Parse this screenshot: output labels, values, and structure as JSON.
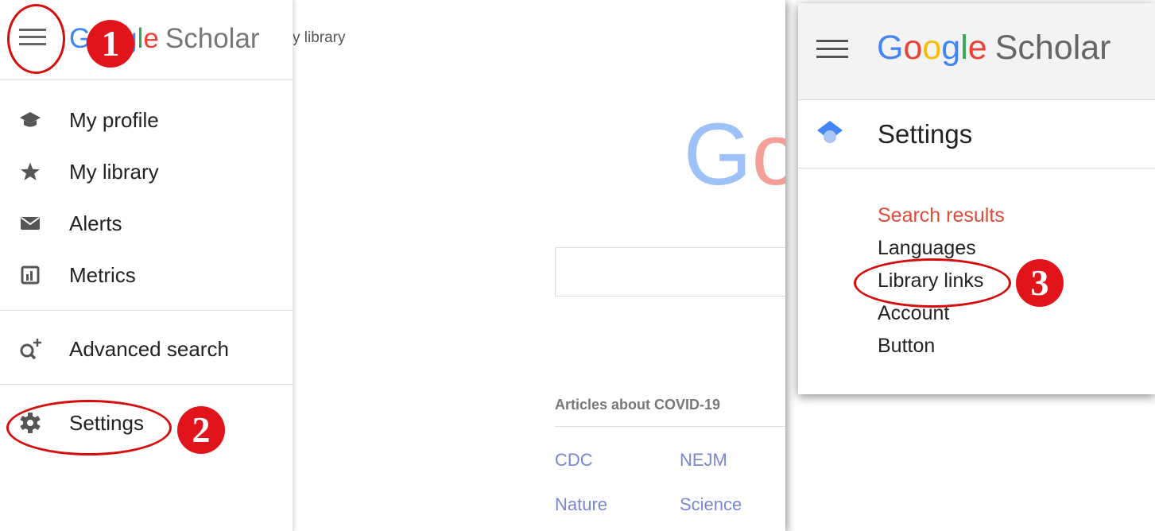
{
  "left_panel": {
    "background": {
      "breadcrumb_fragment": "y library",
      "logo_fragment": "Go",
      "articles_title": "Articles about COVID-19",
      "links": [
        "CDC",
        "NEJM",
        "Nature",
        "Science"
      ]
    },
    "drawer": {
      "logo": {
        "g": "G",
        "o1": "o",
        "o2": "o",
        "g2": "g",
        "l": "l",
        "e": "e",
        "scholar": "Scholar"
      },
      "items": [
        {
          "label": "My profile",
          "icon": "graduation-cap-icon"
        },
        {
          "label": "My library",
          "icon": "star-icon"
        },
        {
          "label": "Alerts",
          "icon": "envelope-icon"
        },
        {
          "label": "Metrics",
          "icon": "metrics-icon"
        },
        {
          "label": "Advanced search",
          "icon": "advanced-search-icon"
        },
        {
          "label": "Settings",
          "icon": "gear-icon"
        }
      ]
    }
  },
  "right_panel": {
    "logo": {
      "g": "G",
      "o1": "o",
      "o2": "o",
      "g2": "g",
      "l": "l",
      "e": "e",
      "scholar": "Scholar"
    },
    "title": "Settings",
    "nav": [
      {
        "label": "Search results",
        "active": true
      },
      {
        "label": "Languages",
        "active": false
      },
      {
        "label": "Library links",
        "active": false
      },
      {
        "label": "Account",
        "active": false
      },
      {
        "label": "Button",
        "active": false
      }
    ]
  },
  "annotations": {
    "step1": "1",
    "step2": "2",
    "step3": "3"
  },
  "colors": {
    "google_blue": "#4285f4",
    "google_red": "#ea4335",
    "google_yellow": "#fbbc05",
    "google_green": "#34a853",
    "active_nav": "#dd4b39",
    "annotation_red": "#e0141a",
    "link": "#7a86d0"
  }
}
